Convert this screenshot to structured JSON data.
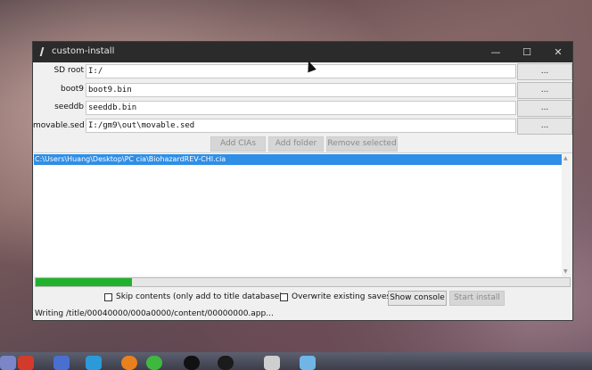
{
  "window": {
    "title": "custom-install",
    "minimize": "—",
    "maximize": "☐",
    "close": "✕"
  },
  "fields": [
    {
      "label": "SD root",
      "value": "I:/",
      "browse": "..."
    },
    {
      "label": "boot9",
      "value": "boot9.bin",
      "browse": "..."
    },
    {
      "label": "seeddb",
      "value": "seeddb.bin",
      "browse": "..."
    },
    {
      "label": "movable.sed",
      "value": "I:/gm9\\out\\movable.sed",
      "browse": "..."
    }
  ],
  "actions": {
    "add_cias": "Add CIAs",
    "add_folder": "Add folder",
    "remove_selected": "Remove selected"
  },
  "list": {
    "items": [
      "C:\\Users\\Huang\\Desktop\\PC cia\\BiohazardREV-CHI.cia"
    ]
  },
  "progress": {
    "fraction": 0.18,
    "color": "#22b12c"
  },
  "options": {
    "skip_contents": "Skip contents (only add to title database)",
    "overwrite_saves": "Overwrite existing saves",
    "show_console": "Show console",
    "start_install": "Start install"
  },
  "status": "Writing /title/00040000/000a0000/content/00000000.app..."
}
